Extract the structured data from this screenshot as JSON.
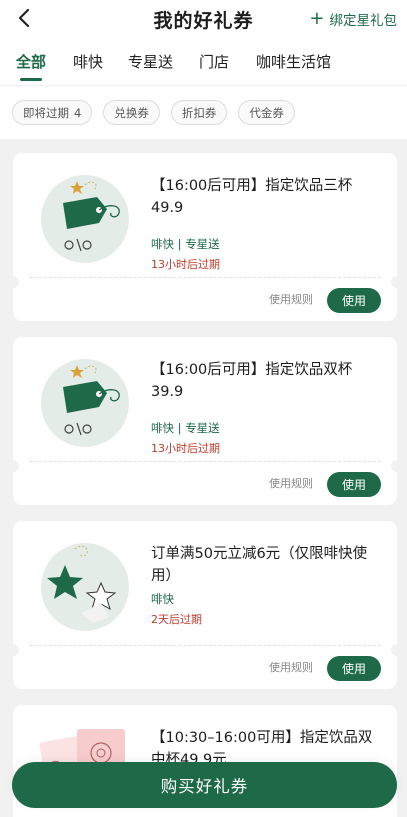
{
  "header": {
    "title": "我的好礼券",
    "bind_label": "绑定星礼包",
    "back_icon": "chevron-left-icon",
    "plus_icon": "plus-icon"
  },
  "tabs": [
    {
      "label": "全部",
      "active": true
    },
    {
      "label": "啡快",
      "active": false
    },
    {
      "label": "专星送",
      "active": false
    },
    {
      "label": "门店",
      "active": false
    },
    {
      "label": "咖啡生活馆",
      "active": false
    }
  ],
  "filters": [
    {
      "label": "即将过期",
      "count": "4"
    },
    {
      "label": "兑换券"
    },
    {
      "label": "折扣券"
    },
    {
      "label": "代金券"
    }
  ],
  "coupons": [
    {
      "title": "【16:00后可用】指定饮品三杯49.9",
      "channels": "啡快 | 专星送",
      "expire": "13小时后过期",
      "rules_label": "使用规则",
      "use_label": "使用",
      "icon": "price-tag-icon"
    },
    {
      "title": "【16:00后可用】指定饮品双杯39.9",
      "channels": "啡快 | 专星送",
      "expire": "13小时后过期",
      "rules_label": "使用规则",
      "use_label": "使用",
      "icon": "price-tag-icon"
    },
    {
      "title": "订单满50元立减6元（仅限啡快使用）",
      "channels": "啡快",
      "expire": "2天后过期",
      "rules_label": "使用规则",
      "use_label": "使用",
      "icon": "stars-icon"
    },
    {
      "title": "【10:30–16:00可用】指定饮品双中杯49.9元",
      "icon": "cups-icon"
    }
  ],
  "bottom": {
    "buy_label": "购买好礼券"
  },
  "colors": {
    "brand": "#1e6a48",
    "expire": "#c0392b",
    "background": "#f1f1f1"
  }
}
